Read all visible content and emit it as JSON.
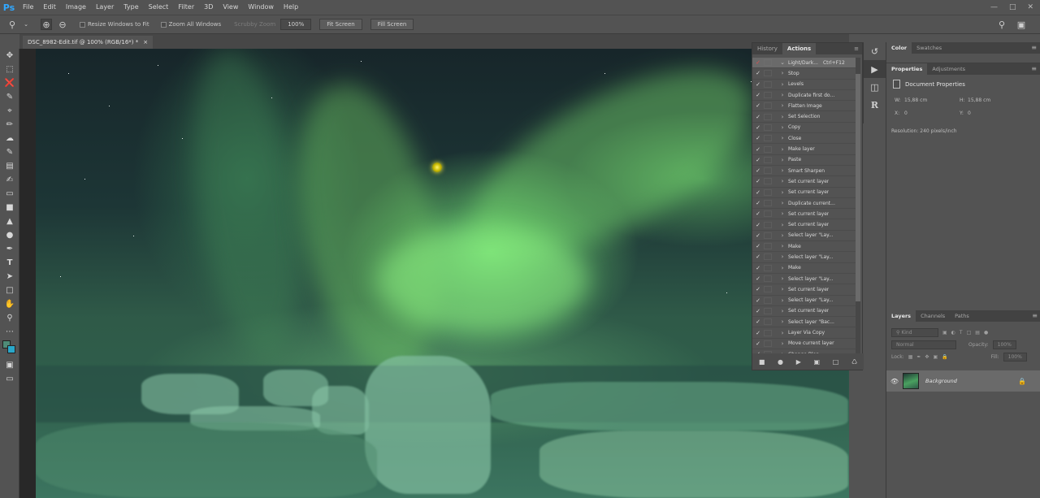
{
  "app": {
    "logo": "Ps"
  },
  "menu": [
    "File",
    "Edit",
    "Image",
    "Layer",
    "Type",
    "Select",
    "Filter",
    "3D",
    "View",
    "Window",
    "Help"
  ],
  "window_controls": {
    "minimize": "—",
    "maximize": "□",
    "close": "✕"
  },
  "options_bar": {
    "resize_windows": "Resize Windows to Fit",
    "zoom_all": "Zoom All Windows",
    "scrubby_zoom": "Scrubby Zoom",
    "zoom_value": "100%",
    "fit_screen": "Fit Screen",
    "fill_screen": "Fill Screen"
  },
  "document": {
    "tab_title": "DSC_8982-Edit.tif @ 100% (RGB/16*) *",
    "close": "×"
  },
  "actions_panel": {
    "tabs": [
      "History",
      "Actions"
    ],
    "active_tab": "Actions",
    "set_name": "Light/Dark...",
    "set_shortcut": "Ctrl+F12",
    "items": [
      "Stop",
      "Levels",
      "Duplicate first do...",
      "Flatten Image",
      "Set Selection",
      "Copy",
      "Close",
      "Make layer",
      "Paste",
      "Smart Sharpen",
      "Set current layer",
      "Set current layer",
      "Duplicate current...",
      "Set current layer",
      "Set current layer",
      "Select layer \"Lay...",
      "Make",
      "Select layer \"Lay...",
      "Make",
      "Select layer \"Lay...",
      "Set current layer",
      "Select layer \"Lay...",
      "Set current layer",
      "Select layer \"Bac...",
      "Layer Via Copy",
      "Move current layer",
      "Change Blen..."
    ]
  },
  "color_panel": {
    "tabs": [
      "Color",
      "Swatches"
    ],
    "active_tab": "Color"
  },
  "properties_panel": {
    "tabs": [
      "Properties",
      "Adjustments"
    ],
    "active_tab": "Properties",
    "heading": "Document Properties",
    "w_label": "W:",
    "w_value": "15,88 cm",
    "h_label": "H:",
    "h_value": "15,88 cm",
    "x_label": "X:",
    "x_value": "0",
    "y_label": "Y:",
    "y_value": "0",
    "resolution": "Resolution: 240 pixels/inch"
  },
  "layers_panel": {
    "tabs": [
      "Layers",
      "Channels",
      "Paths"
    ],
    "active_tab": "Layers",
    "filter_label": "Kind",
    "blend_mode": "Normal",
    "opacity_label": "Opacity:",
    "opacity_value": "100%",
    "lock_label": "Lock:",
    "fill_label": "Fill:",
    "fill_value": "100%",
    "layer_name": "Background"
  },
  "colors": {
    "foreground_swatch": "#4f8b78",
    "background_swatch": "#2aa7c9",
    "ps_logo": "#31a8ff"
  }
}
